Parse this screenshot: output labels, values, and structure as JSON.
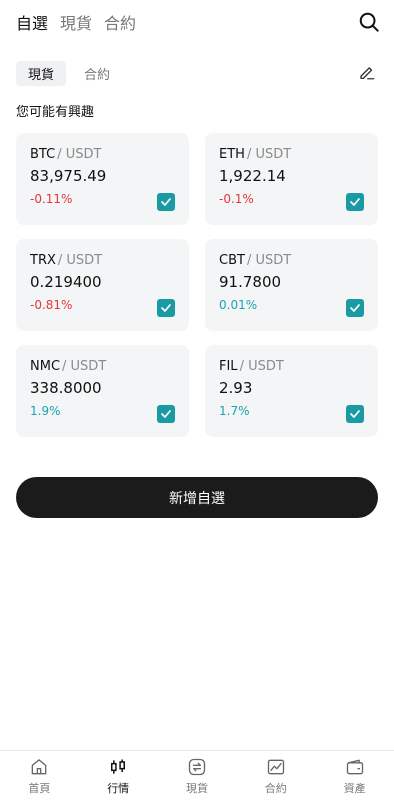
{
  "header": {
    "tabs": [
      {
        "label": "自選",
        "active": true
      },
      {
        "label": "現貨",
        "active": false
      },
      {
        "label": "合約",
        "active": false
      }
    ]
  },
  "sub_tabs": [
    {
      "label": "現貨",
      "active": true
    },
    {
      "label": "合約",
      "active": false
    }
  ],
  "section_title": "您可能有興趣",
  "cards": [
    {
      "base": "BTC",
      "quote": "/ USDT",
      "price": "83,975.49",
      "change": "-0.11%",
      "direction": "down",
      "checked": true
    },
    {
      "base": "ETH",
      "quote": "/ USDT",
      "price": "1,922.14",
      "change": "-0.1%",
      "direction": "down",
      "checked": true
    },
    {
      "base": "TRX",
      "quote": "/ USDT",
      "price": "0.219400",
      "change": "-0.81%",
      "direction": "down",
      "checked": true
    },
    {
      "base": "CBT",
      "quote": "/ USDT",
      "price": "91.7800",
      "change": "0.01%",
      "direction": "up",
      "checked": true
    },
    {
      "base": "NMC",
      "quote": "/ USDT",
      "price": "338.8000",
      "change": "1.9%",
      "direction": "up",
      "checked": true
    },
    {
      "base": "FIL",
      "quote": "/ USDT",
      "price": "2.93",
      "change": "1.7%",
      "direction": "up",
      "checked": true
    }
  ],
  "add_button_label": "新增自選",
  "bottom_nav": [
    {
      "label": "首頁",
      "icon": "home-icon",
      "active": false
    },
    {
      "label": "行情",
      "icon": "candlestick-icon",
      "active": true
    },
    {
      "label": "現貨",
      "icon": "exchange-icon",
      "active": false
    },
    {
      "label": "合約",
      "icon": "contract-chart-icon",
      "active": false
    },
    {
      "label": "資產",
      "icon": "wallet-icon",
      "active": false
    }
  ],
  "colors": {
    "accent": "#1a9aa3",
    "down": "#e0393c",
    "up": "#1aa3ae",
    "button": "#1b1b1b"
  }
}
